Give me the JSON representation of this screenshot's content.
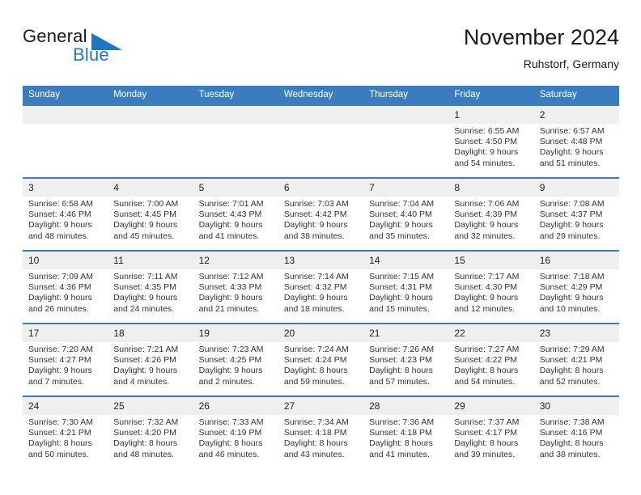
{
  "brand": {
    "name_part1": "General",
    "name_part2": "Blue",
    "triangle_color": "#1f77c4"
  },
  "header": {
    "title": "November 2024",
    "location": "Ruhstorf, Germany"
  },
  "theme": {
    "header_blue": "#3b7cc0",
    "daynum_band": "#efefef",
    "text": "#333333"
  },
  "weekdays": [
    "Sunday",
    "Monday",
    "Tuesday",
    "Wednesday",
    "Thursday",
    "Friday",
    "Saturday"
  ],
  "weeks": [
    [
      {
        "day": "",
        "empty": true
      },
      {
        "day": "",
        "empty": true
      },
      {
        "day": "",
        "empty": true
      },
      {
        "day": "",
        "empty": true
      },
      {
        "day": "",
        "empty": true
      },
      {
        "day": "1",
        "sunrise": "Sunrise: 6:55 AM",
        "sunset": "Sunset: 4:50 PM",
        "daylight": "Daylight: 9 hours and 54 minutes."
      },
      {
        "day": "2",
        "sunrise": "Sunrise: 6:57 AM",
        "sunset": "Sunset: 4:48 PM",
        "daylight": "Daylight: 9 hours and 51 minutes."
      }
    ],
    [
      {
        "day": "3",
        "sunrise": "Sunrise: 6:58 AM",
        "sunset": "Sunset: 4:46 PM",
        "daylight": "Daylight: 9 hours and 48 minutes."
      },
      {
        "day": "4",
        "sunrise": "Sunrise: 7:00 AM",
        "sunset": "Sunset: 4:45 PM",
        "daylight": "Daylight: 9 hours and 45 minutes."
      },
      {
        "day": "5",
        "sunrise": "Sunrise: 7:01 AM",
        "sunset": "Sunset: 4:43 PM",
        "daylight": "Daylight: 9 hours and 41 minutes."
      },
      {
        "day": "6",
        "sunrise": "Sunrise: 7:03 AM",
        "sunset": "Sunset: 4:42 PM",
        "daylight": "Daylight: 9 hours and 38 minutes."
      },
      {
        "day": "7",
        "sunrise": "Sunrise: 7:04 AM",
        "sunset": "Sunset: 4:40 PM",
        "daylight": "Daylight: 9 hours and 35 minutes."
      },
      {
        "day": "8",
        "sunrise": "Sunrise: 7:06 AM",
        "sunset": "Sunset: 4:39 PM",
        "daylight": "Daylight: 9 hours and 32 minutes."
      },
      {
        "day": "9",
        "sunrise": "Sunrise: 7:08 AM",
        "sunset": "Sunset: 4:37 PM",
        "daylight": "Daylight: 9 hours and 29 minutes."
      }
    ],
    [
      {
        "day": "10",
        "sunrise": "Sunrise: 7:09 AM",
        "sunset": "Sunset: 4:36 PM",
        "daylight": "Daylight: 9 hours and 26 minutes."
      },
      {
        "day": "11",
        "sunrise": "Sunrise: 7:11 AM",
        "sunset": "Sunset: 4:35 PM",
        "daylight": "Daylight: 9 hours and 24 minutes."
      },
      {
        "day": "12",
        "sunrise": "Sunrise: 7:12 AM",
        "sunset": "Sunset: 4:33 PM",
        "daylight": "Daylight: 9 hours and 21 minutes."
      },
      {
        "day": "13",
        "sunrise": "Sunrise: 7:14 AM",
        "sunset": "Sunset: 4:32 PM",
        "daylight": "Daylight: 9 hours and 18 minutes."
      },
      {
        "day": "14",
        "sunrise": "Sunrise: 7:15 AM",
        "sunset": "Sunset: 4:31 PM",
        "daylight": "Daylight: 9 hours and 15 minutes."
      },
      {
        "day": "15",
        "sunrise": "Sunrise: 7:17 AM",
        "sunset": "Sunset: 4:30 PM",
        "daylight": "Daylight: 9 hours and 12 minutes."
      },
      {
        "day": "16",
        "sunrise": "Sunrise: 7:18 AM",
        "sunset": "Sunset: 4:29 PM",
        "daylight": "Daylight: 9 hours and 10 minutes."
      }
    ],
    [
      {
        "day": "17",
        "sunrise": "Sunrise: 7:20 AM",
        "sunset": "Sunset: 4:27 PM",
        "daylight": "Daylight: 9 hours and 7 minutes."
      },
      {
        "day": "18",
        "sunrise": "Sunrise: 7:21 AM",
        "sunset": "Sunset: 4:26 PM",
        "daylight": "Daylight: 9 hours and 4 minutes."
      },
      {
        "day": "19",
        "sunrise": "Sunrise: 7:23 AM",
        "sunset": "Sunset: 4:25 PM",
        "daylight": "Daylight: 9 hours and 2 minutes."
      },
      {
        "day": "20",
        "sunrise": "Sunrise: 7:24 AM",
        "sunset": "Sunset: 4:24 PM",
        "daylight": "Daylight: 8 hours and 59 minutes."
      },
      {
        "day": "21",
        "sunrise": "Sunrise: 7:26 AM",
        "sunset": "Sunset: 4:23 PM",
        "daylight": "Daylight: 8 hours and 57 minutes."
      },
      {
        "day": "22",
        "sunrise": "Sunrise: 7:27 AM",
        "sunset": "Sunset: 4:22 PM",
        "daylight": "Daylight: 8 hours and 54 minutes."
      },
      {
        "day": "23",
        "sunrise": "Sunrise: 7:29 AM",
        "sunset": "Sunset: 4:21 PM",
        "daylight": "Daylight: 8 hours and 52 minutes."
      }
    ],
    [
      {
        "day": "24",
        "sunrise": "Sunrise: 7:30 AM",
        "sunset": "Sunset: 4:21 PM",
        "daylight": "Daylight: 8 hours and 50 minutes."
      },
      {
        "day": "25",
        "sunrise": "Sunrise: 7:32 AM",
        "sunset": "Sunset: 4:20 PM",
        "daylight": "Daylight: 8 hours and 48 minutes."
      },
      {
        "day": "26",
        "sunrise": "Sunrise: 7:33 AM",
        "sunset": "Sunset: 4:19 PM",
        "daylight": "Daylight: 8 hours and 46 minutes."
      },
      {
        "day": "27",
        "sunrise": "Sunrise: 7:34 AM",
        "sunset": "Sunset: 4:18 PM",
        "daylight": "Daylight: 8 hours and 43 minutes."
      },
      {
        "day": "28",
        "sunrise": "Sunrise: 7:36 AM",
        "sunset": "Sunset: 4:18 PM",
        "daylight": "Daylight: 8 hours and 41 minutes."
      },
      {
        "day": "29",
        "sunrise": "Sunrise: 7:37 AM",
        "sunset": "Sunset: 4:17 PM",
        "daylight": "Daylight: 8 hours and 39 minutes."
      },
      {
        "day": "30",
        "sunrise": "Sunrise: 7:38 AM",
        "sunset": "Sunset: 4:16 PM",
        "daylight": "Daylight: 8 hours and 38 minutes."
      }
    ]
  ]
}
